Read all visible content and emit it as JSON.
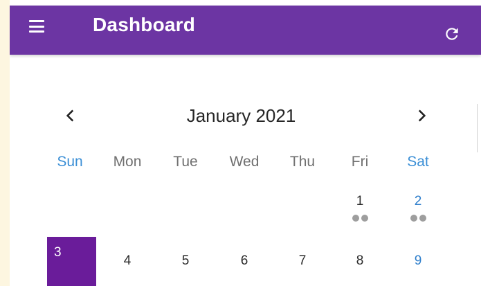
{
  "appbar": {
    "title": "Dashboard",
    "menu_icon": "hamburger-menu-icon",
    "refresh_icon": "refresh-icon",
    "color": "#6c35a3"
  },
  "calendar": {
    "month_label": "January 2021",
    "prev_icon": "chevron-left-icon",
    "next_icon": "chevron-right-icon",
    "weekdays": [
      "Sun",
      "Mon",
      "Tue",
      "Wed",
      "Thu",
      "Fri",
      "Sat"
    ],
    "weekend_color": "#3b8fd6",
    "selected_color": "#6a1c9a",
    "weeks": [
      [
        {
          "day": ""
        },
        {
          "day": ""
        },
        {
          "day": ""
        },
        {
          "day": ""
        },
        {
          "day": ""
        },
        {
          "day": "1",
          "dots": 2
        },
        {
          "day": "2",
          "dots": 2
        }
      ],
      [
        {
          "day": "3",
          "selected": true
        },
        {
          "day": "4"
        },
        {
          "day": "5"
        },
        {
          "day": "6"
        },
        {
          "day": "7"
        },
        {
          "day": "8"
        },
        {
          "day": "9"
        }
      ]
    ]
  }
}
